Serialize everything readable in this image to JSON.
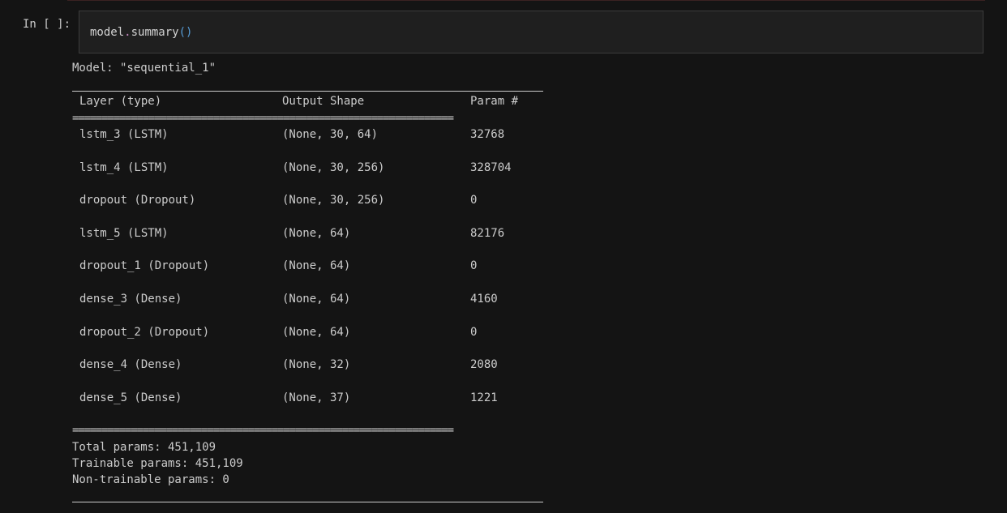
{
  "prompt": "In [ ]:",
  "code": {
    "var": "model",
    "dot": ".",
    "fn": "summary",
    "parens": "()"
  },
  "output": {
    "model_line": "Model: \"sequential_1\"",
    "headers": {
      "layer": "Layer (type)",
      "shape": "Output Shape",
      "param": "Param #"
    },
    "rows": [
      {
        "layer": "lstm_3 (LSTM)",
        "shape": "(None, 30, 64)",
        "param": "32768"
      },
      {
        "layer": "lstm_4 (LSTM)",
        "shape": "(None, 30, 256)",
        "param": "328704"
      },
      {
        "layer": "dropout (Dropout)",
        "shape": "(None, 30, 256)",
        "param": "0"
      },
      {
        "layer": "lstm_5 (LSTM)",
        "shape": "(None, 64)",
        "param": "82176"
      },
      {
        "layer": "dropout_1 (Dropout)",
        "shape": "(None, 64)",
        "param": "0"
      },
      {
        "layer": "dense_3 (Dense)",
        "shape": "(None, 64)",
        "param": "4160"
      },
      {
        "layer": "dropout_2 (Dropout)",
        "shape": "(None, 64)",
        "param": "0"
      },
      {
        "layer": "dense_4 (Dense)",
        "shape": "(None, 32)",
        "param": "2080"
      },
      {
        "layer": "dense_5 (Dense)",
        "shape": "(None, 37)",
        "param": "1221"
      }
    ],
    "separator": "=================================================================",
    "total_params": "Total params: 451,109",
    "trainable_params": "Trainable params: 451,109",
    "non_trainable_params": "Non-trainable params: 0"
  }
}
